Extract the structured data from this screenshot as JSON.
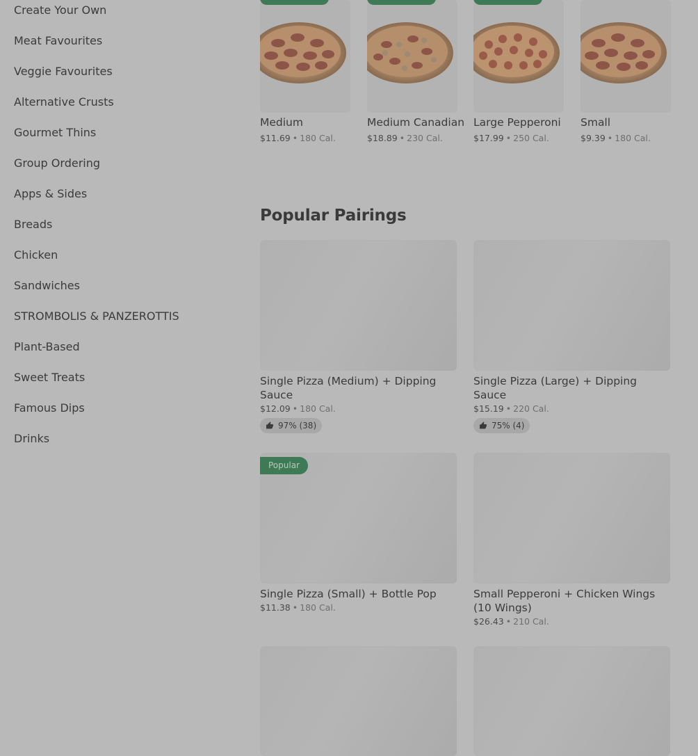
{
  "sidebar": {
    "items": [
      {
        "label": "Create Your Own"
      },
      {
        "label": "Meat Favourites"
      },
      {
        "label": "Veggie Favourites"
      },
      {
        "label": "Alternative Crusts"
      },
      {
        "label": "Gourmet Thins"
      },
      {
        "label": "Group Ordering"
      },
      {
        "label": "Apps & Sides"
      },
      {
        "label": "Breads"
      },
      {
        "label": "Chicken"
      },
      {
        "label": "Sandwiches"
      },
      {
        "label": "STROMBOLIS & PANZEROTTIS"
      },
      {
        "label": "Plant-Based"
      },
      {
        "label": "Sweet Treats"
      },
      {
        "label": "Famous Dips"
      },
      {
        "label": "Drinks"
      }
    ]
  },
  "top_items": [
    {
      "name": "Medium",
      "price": "$11.69",
      "cal": "180 Cal."
    },
    {
      "name": "Medium Canadian",
      "price": "$18.89",
      "cal": "230 Cal."
    },
    {
      "name": "Large Pepperoni",
      "price": "$17.99",
      "cal": "250 Cal."
    },
    {
      "name": "Small",
      "price": "$9.39",
      "cal": "180 Cal."
    }
  ],
  "pairings": {
    "title": "Popular Pairings",
    "items": [
      {
        "name": "Single Pizza (Medium) + Dipping Sauce",
        "price": "$12.09",
        "cal": "180 Cal.",
        "rating": "97% (38)"
      },
      {
        "name": "Single Pizza (Large) + Dipping Sauce",
        "price": "$15.19",
        "cal": "220 Cal.",
        "rating": "75% (4)"
      },
      {
        "name": "Single Pizza (Small) + Bottle Pop",
        "price": "$11.38",
        "cal": "180 Cal.",
        "badge": "Popular"
      },
      {
        "name": "Small Pepperoni + Chicken Wings (10 Wings)",
        "price": "$26.43",
        "cal": "210 Cal."
      }
    ]
  },
  "separator": "•",
  "colors": {
    "overlay_bg": "#b9b9b9",
    "accent": "#3f7a57"
  },
  "icons": {
    "rating": "thumbs-up-icon"
  }
}
